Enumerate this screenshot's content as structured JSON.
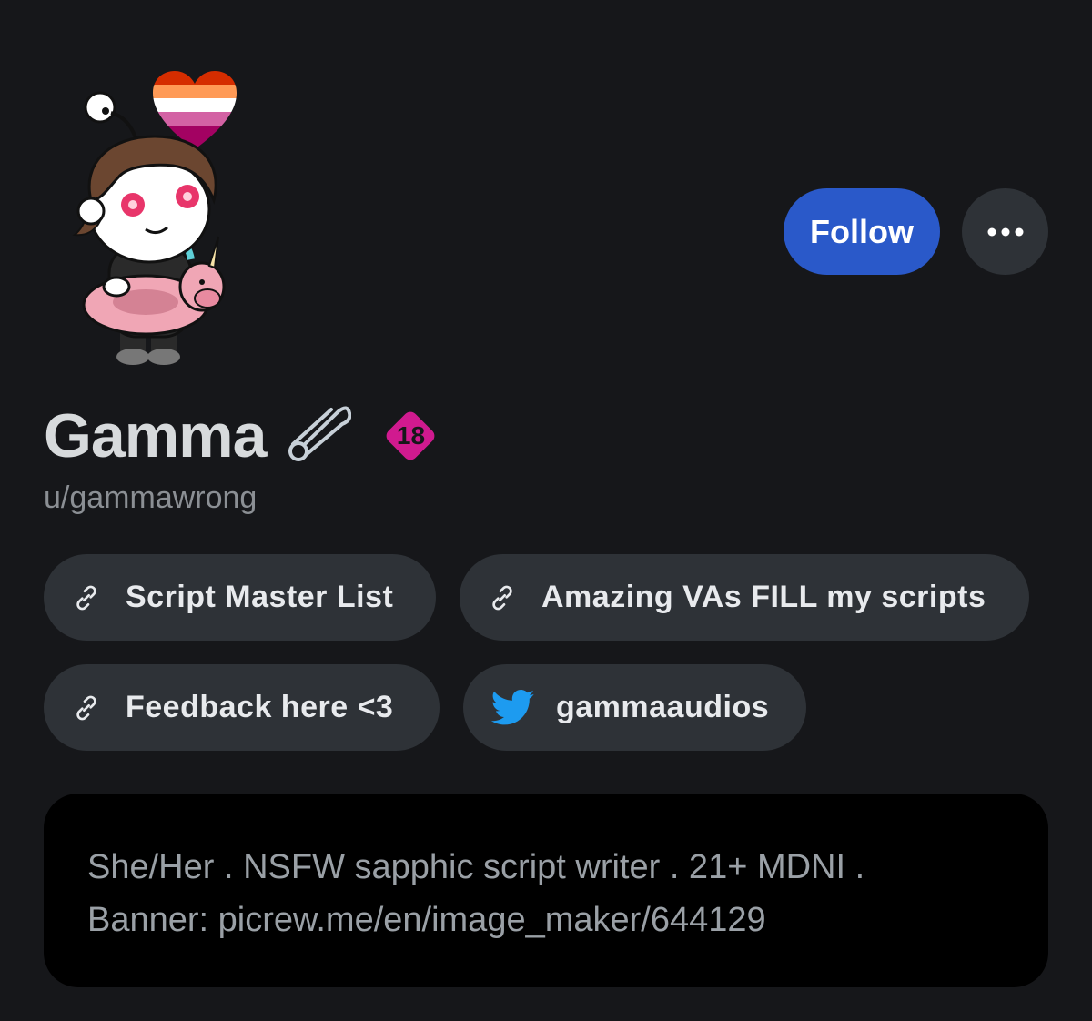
{
  "profile": {
    "display_name": "Gamma",
    "username": "u/gammawrong",
    "nsfw_badge": "18",
    "follow_label": "Follow",
    "more_icon": "ellipsis-icon"
  },
  "links": [
    {
      "icon": "link-icon",
      "label": "Script Master List"
    },
    {
      "icon": "link-icon",
      "label": "Amazing VAs FILL my scripts"
    },
    {
      "icon": "link-icon",
      "label": "Feedback here <3"
    },
    {
      "icon": "twitter-icon",
      "label": "gammaaudios"
    }
  ],
  "bio": {
    "line1": "She/Her . NSFW sapphic script writer . 21+ MDNI .",
    "line2": "Banner: picrew.me/en/image_maker/644129"
  },
  "colors": {
    "background": "#16171a",
    "accent": "#2a59c9",
    "pill": "#2e3237",
    "nsfw": "#d01a8f"
  }
}
